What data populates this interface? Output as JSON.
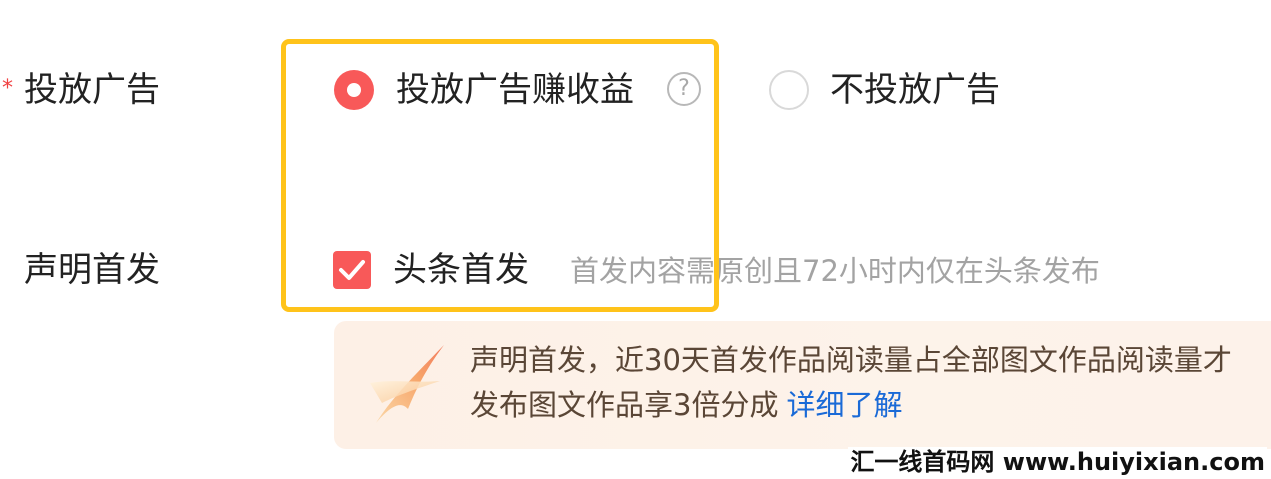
{
  "form": {
    "ad_field": {
      "required_mark": "*",
      "label": "投放广告",
      "options": [
        {
          "label": "投放广告赚收益",
          "selected": true
        },
        {
          "label": "不投放广告",
          "selected": false
        }
      ],
      "help_icon": "question-circle-icon",
      "help_glyph": "?"
    },
    "first_publish": {
      "label": "声明首发",
      "checkbox_label": "头条首发",
      "checked": true,
      "hint": "首发内容需原创且72小时内仅在头条发布"
    },
    "notice": {
      "line1": "声明首发，近30天首发作品阅读量占全部图文作品阅读量才",
      "line2": "发布图文作品享3倍分成",
      "link": "详细了解"
    }
  },
  "watermark": "汇一线首码网 www.huiyixian.com",
  "colors": {
    "accent": "#f85959",
    "highlight": "#ffc31a",
    "link": "#1a6ad7",
    "hint": "#a3a3a3",
    "notice_bg": "#fdf1e8"
  }
}
